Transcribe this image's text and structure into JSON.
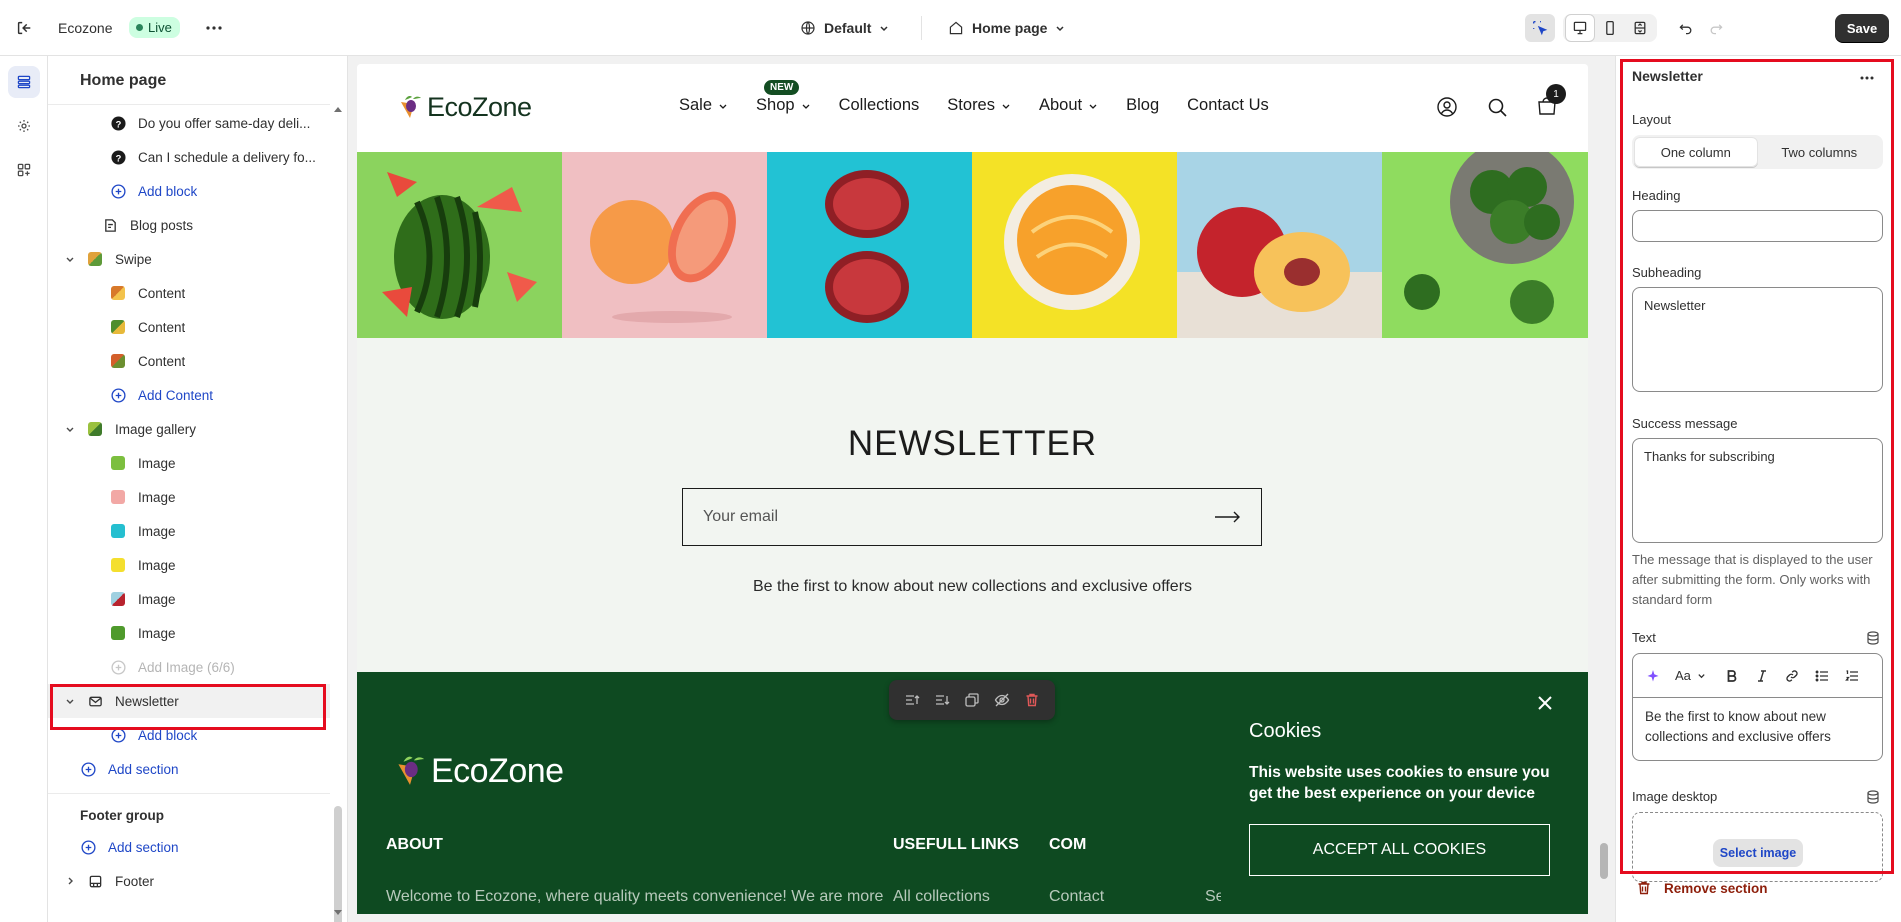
{
  "topbar": {
    "store_name": "Ecozone",
    "status_badge": "Live",
    "theme_label": "Default",
    "page_label": "Home page",
    "save_label": "Save"
  },
  "sidebar": {
    "title": "Home page",
    "rows": [
      {
        "label": "Do you offer same-day deli...",
        "icon": "question-icon"
      },
      {
        "label": "Can I schedule a delivery fo...",
        "icon": "question-icon"
      },
      {
        "label": "Add block",
        "icon": "add-icon"
      },
      {
        "label": "Blog posts",
        "icon": "blog-icon"
      },
      {
        "label": "Swipe",
        "icon": "swipe-thumb"
      },
      {
        "label": "Content",
        "icon": "content-thumb"
      },
      {
        "label": "Content",
        "icon": "content-thumb"
      },
      {
        "label": "Content",
        "icon": "content-thumb"
      },
      {
        "label": "Add Content",
        "icon": "add-icon"
      },
      {
        "label": "Image gallery",
        "icon": "gallery-thumb"
      },
      {
        "label": "Image",
        "icon": "image-thumb"
      },
      {
        "label": "Image",
        "icon": "image-thumb"
      },
      {
        "label": "Image",
        "icon": "image-thumb"
      },
      {
        "label": "Image",
        "icon": "image-thumb"
      },
      {
        "label": "Image",
        "icon": "image-thumb"
      },
      {
        "label": "Image",
        "icon": "image-thumb"
      },
      {
        "label": "Add Image (6/6)",
        "icon": "add-icon"
      },
      {
        "label": "Newsletter",
        "icon": "mail-icon"
      },
      {
        "label": "Add block",
        "icon": "add-icon"
      },
      {
        "label": "Add section",
        "icon": "add-icon"
      }
    ],
    "footer_group_title": "Footer group",
    "footer_add_section": "Add section",
    "footer_label": "Footer"
  },
  "preview": {
    "logo_text": "EcoZone",
    "nav": [
      {
        "label": "Sale",
        "dropdown": true
      },
      {
        "label": "Shop",
        "dropdown": true,
        "badge": "NEW"
      },
      {
        "label": "Collections",
        "dropdown": false
      },
      {
        "label": "Stores",
        "dropdown": true
      },
      {
        "label": "About",
        "dropdown": true
      },
      {
        "label": "Blog",
        "dropdown": false
      },
      {
        "label": "Contact Us",
        "dropdown": false
      }
    ],
    "cart_count": "1",
    "gallery": [
      "watermelon",
      "grapefruit",
      "pomegranate",
      "tangerine",
      "peach",
      "broccoli"
    ],
    "newsletter": {
      "title": "NEWSLETTER",
      "email_placeholder": "Your email",
      "subtext": "Be the first to know about new collections and exclusive offers"
    },
    "footer": {
      "logo_text": "EcoZone",
      "col_about": "ABOUT",
      "col_links": "USEFULL LINKS",
      "col_contact": "COM",
      "about_text": "Welcome to Ecozone, where quality meets convenience! We are more",
      "link_1": "All collections",
      "link_2": "Contact",
      "link_3": "Search"
    },
    "cookies": {
      "title": "Cookies",
      "text": "This website uses cookies to ensure you get the best experience on your device",
      "button": "ACCEPT ALL COOKIES"
    }
  },
  "settings": {
    "title": "Newsletter",
    "layout_label": "Layout",
    "layout_options": [
      "One column",
      "Two columns"
    ],
    "layout_selected": "One column",
    "heading_label": "Heading",
    "heading_value": "",
    "subheading_label": "Subheading",
    "subheading_value": "Newsletter",
    "success_label": "Success message",
    "success_value": "Thanks for subscribing",
    "success_help": "The message that is displayed to the user after submitting the form. Only works with standard form",
    "text_label": "Text",
    "text_value": "Be the first to know about new collections and exclusive offers",
    "font_tool": "Aa",
    "image_desktop_label": "Image desktop",
    "select_image": "Select image",
    "remove_section": "Remove section"
  },
  "colors": {
    "accent": "#1f47c7",
    "highlight": "#e50c1f",
    "footer_green": "#0e4a21",
    "newsletter_bg": "#f2f5f1",
    "live_bg": "#cdfee1"
  }
}
